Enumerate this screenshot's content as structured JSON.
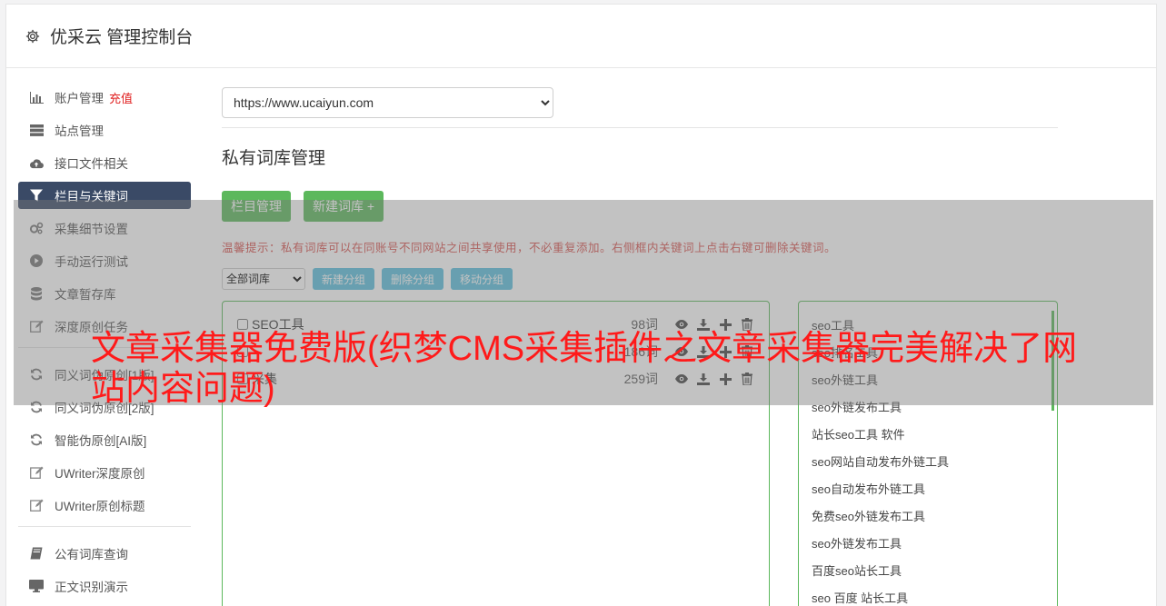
{
  "header": {
    "title": "优采云 管理控制台"
  },
  "sidebar": {
    "items": [
      {
        "label": "账户管理",
        "badge": "充值",
        "icon": "bar-chart-icon"
      },
      {
        "label": "站点管理",
        "icon": "server-icon"
      },
      {
        "label": "接口文件相关",
        "icon": "cloud-upload-icon"
      },
      {
        "label": "栏目与关键词",
        "icon": "filter-icon",
        "active": true
      },
      {
        "label": "采集细节设置",
        "icon": "cogs-icon"
      },
      {
        "label": "手动运行测试",
        "icon": "play-circle-icon"
      },
      {
        "label": "文章暂存库",
        "icon": "database-icon"
      },
      {
        "label": "深度原创任务",
        "icon": "edit-icon"
      }
    ],
    "items2": [
      {
        "label": "同义词伪原创[1版]",
        "icon": "refresh-icon"
      },
      {
        "label": "同义词伪原创[2版]",
        "icon": "refresh-icon"
      },
      {
        "label": "智能伪原创[AI版]",
        "icon": "refresh-icon"
      },
      {
        "label": "UWriter深度原创",
        "icon": "edit-icon"
      },
      {
        "label": "UWriter原创标题",
        "icon": "edit-icon"
      }
    ],
    "items3": [
      {
        "label": "公有词库查询",
        "icon": "book-icon"
      },
      {
        "label": "正文识别演示",
        "icon": "monitor-icon"
      }
    ]
  },
  "main": {
    "site_select": "https://www.ucaiyun.com",
    "section_title": "私有词库管理",
    "btn_column": "栏目管理",
    "btn_new_lib": "新建词库 +",
    "tip": "温馨提示：私有词库可以在同账号不同网站之间共享使用，不必重复添加。右侧框内关键词上点击右键可删除关键词。",
    "group_select": "全部词库",
    "btn_new_group": "新建分组",
    "btn_del_group": "删除分组",
    "btn_move_group": "移动分组",
    "libraries": [
      {
        "name": "SEO工具",
        "count": "98词"
      },
      {
        "name": "",
        "count": "186词"
      },
      {
        "name": "采集",
        "count": "259词"
      }
    ],
    "keywords": [
      "seo工具",
      "seo排名工具",
      "seo外链工具",
      "seo外链发布工具",
      "站长seo工具 软件",
      "seo网站自动发布外链工具",
      "seo自动发布外链工具",
      "免费seo外链发布工具",
      "seo外链发布工具",
      "百度seo站长工具",
      "seo 百度 站长工具"
    ]
  },
  "overlay": {
    "headline": "文章采集器免费版(织梦CMS采集插件之文章采集器完美解决了网站内容问题)"
  },
  "colors": {
    "accent_green": "#5cb85c",
    "accent_blue": "#5bc0de",
    "active_nav": "#3a4a66",
    "headline_red": "#ff1a1a"
  }
}
